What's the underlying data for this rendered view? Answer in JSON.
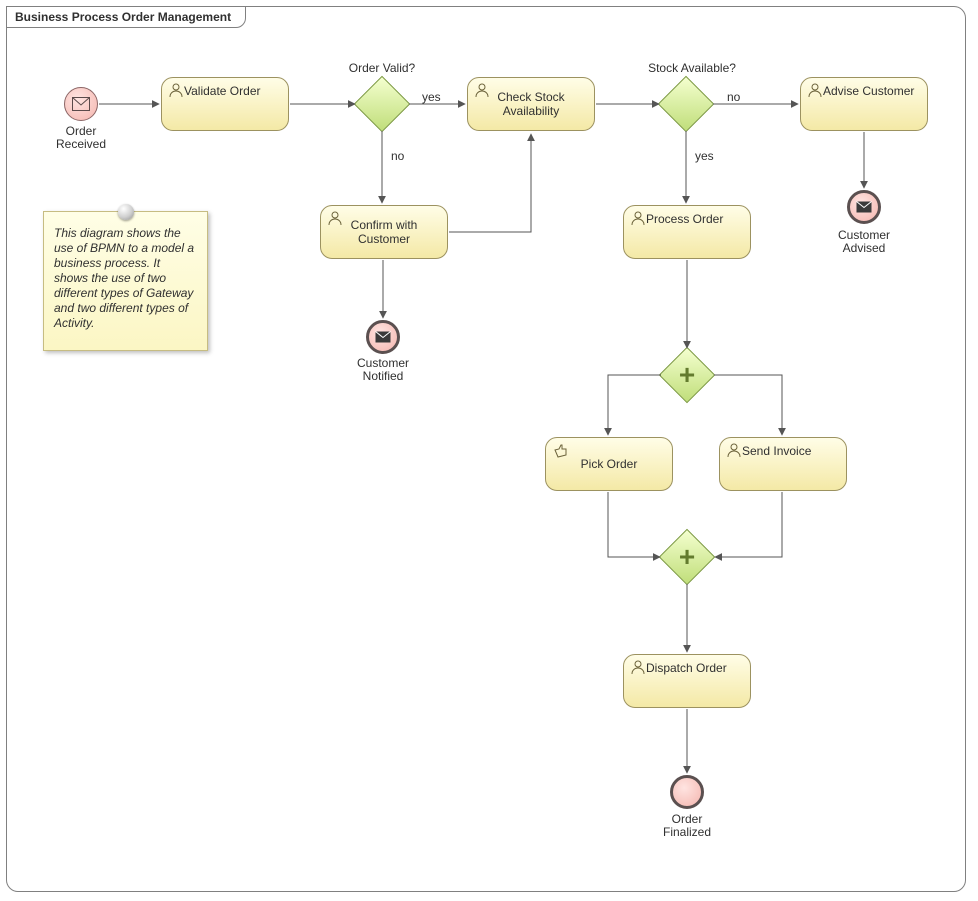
{
  "frame": {
    "title": "Business Process Order Management"
  },
  "events": {
    "orderReceived": "Order\nReceived",
    "customerNotified": "Customer\nNotified",
    "customerAdvised": "Customer\nAdvised",
    "orderFinalized": "Order\nFinalized"
  },
  "tasks": {
    "validateOrder": "Validate Order",
    "confirmWithCustomer": "Confirm with\nCustomer",
    "checkStock": "Check Stock\nAvailability",
    "processOrder": "Process Order",
    "adviseCustomer": "Advise Customer",
    "pickOrder": "Pick Order",
    "sendInvoice": "Send Invoice",
    "dispatchOrder": "Dispatch Order"
  },
  "gateways": {
    "orderValid": "Order Valid?",
    "stockAvailable": "Stock Available?"
  },
  "edgeLabels": {
    "orderValidYes": "yes",
    "orderValidNo": "no",
    "stockYes": "yes",
    "stockNo": "no"
  },
  "note": "This diagram shows the use of BPMN to a model a business process. It shows the use of two different types of Gateway and two different types of Activity."
}
